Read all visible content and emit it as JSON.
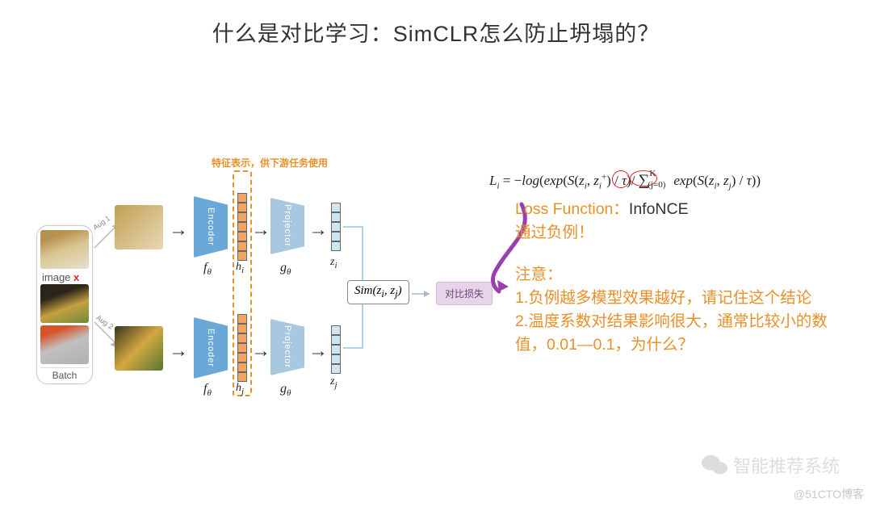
{
  "title": "什么是对比学习：SimCLR怎么防止坍塌的？",
  "diagram": {
    "orange_caption": "特征表示，供下游任务使用",
    "batch": {
      "image_x_prefix": "image",
      "image_x_letter": "x",
      "label": "Batch"
    },
    "aug_labels": {
      "aug1": "Aug 1",
      "aug2": "Aug 2"
    },
    "encoder_label": "Encoder",
    "projector_label": "Projector",
    "f_theta": "f_θ",
    "g_theta": "g_θ",
    "h_i": "h_i",
    "h_j": "h_j",
    "z_i": "z_i",
    "z_j": "z_j",
    "sim_label": "Sim(z_i, z_j)",
    "loss_label": "对比损失"
  },
  "equation_html": "L_i = −log( exp(S(z_i, z_i^+) / τ) / Σ_{(j=0)}^{K} exp(S(z_i, z_j) / τ) )",
  "notes": {
    "loss_name_label": "Loss Function：",
    "loss_name": "InfoNCE",
    "line2": "通过负例！",
    "note_header": "注意：",
    "note1": "1.负例越多模型效果越好，请记住这个结论",
    "note2": "2.温度系数对结果影响很大，通常比较小的数值，0.01—0.1，为什么？"
  },
  "watermark": {
    "wechat_text": "智能推荐系统",
    "cto": "@51CTO博客"
  }
}
